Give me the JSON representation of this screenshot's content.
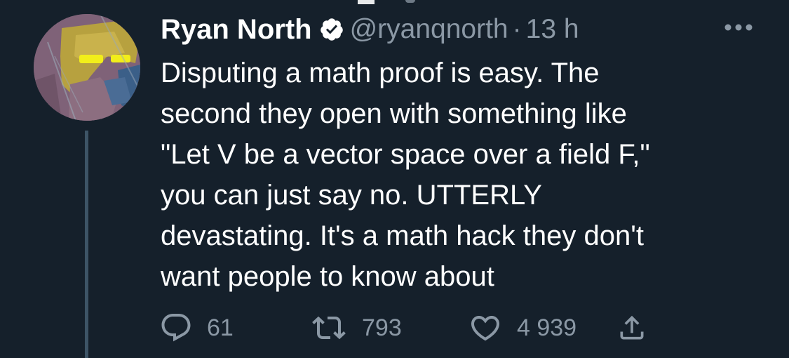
{
  "tweet": {
    "author": {
      "display_name": "Ryan North",
      "handle": "@ryanqnorth",
      "verified": true
    },
    "separator": "·",
    "time": "13 h",
    "text": "Disputing a math proof is easy.  The\nsecond they open with something like\n\"Let V be a vector space over a field F,\"\nyou can just say no. UTTERLY\ndevastating.  It's a math hack they don't\nwant people to know about",
    "actions": {
      "reply_count": "61",
      "retweet_count": "793",
      "like_count": "4 939"
    }
  },
  "icons": [
    "more-icon",
    "verified-badge-icon",
    "reply-icon",
    "retweet-icon",
    "like-icon",
    "share-icon"
  ],
  "colors": {
    "background": "#15202b",
    "text_primary": "#ffffff",
    "text_secondary": "#8b98a5",
    "thread_line": "#3d5466"
  }
}
